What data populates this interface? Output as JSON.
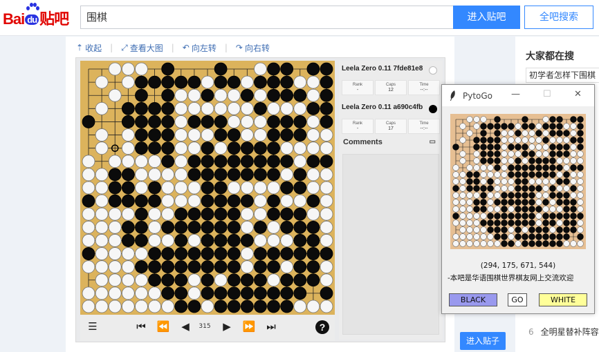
{
  "header": {
    "logo_text_a": "Bai",
    "logo_text_b": "du",
    "logo_text_c": "贴吧",
    "search_value": "围棋",
    "enter_bar_label": "进入贴吧",
    "search_all_label": "全吧搜索"
  },
  "toolbar": {
    "collapse_label": "收起",
    "view_large_label": "查看大图",
    "rotate_left_label": "向左转",
    "rotate_right_label": "向右转"
  },
  "go_viewer": {
    "board_size": 19,
    "last_move": [
      6,
      2
    ],
    "board": [
      "..ooo.x...x..oxx.xx",
      ".o.oxxxxxoxxoxxxoox",
      "..o.x.xooxooxoxxxox",
      ".o.xxxxooooooxoooxx",
      "x..xxxxoxxxoooxxxox",
      ".o.oxxxoooxxooxxxoo",
      ".o.oxxxooxoxxxxoooo",
      "o.ooooxoxxxxxxxxoxx",
      "ooxxooooxxxxxxxoxoo",
      "ooxxoxoooxxooooxxoo",
      "xoxxxxoooxxxxoxooxo",
      "ooooxooxxxxxooxxxoo",
      "oooxxoxxxxxxoxoxxxo",
      "oooxxooxoxxxxoooxxo",
      "xooooxxxxxxxoxxxxxx",
      "ooooxxxxxxxxoxxoxxo",
      ".ooooxxxoxoxxxoxxxo",
      "ooooooxxoxxxxxxxx.x",
      "oooooooxxoxxxxxxooo"
    ],
    "players": [
      {
        "name": "Leela Zero 0.11 7fde81e8",
        "stone": "white",
        "rank_label": "Rank",
        "rank": "-",
        "caps_label": "Caps",
        "caps": "12",
        "time_label": "Time",
        "time": "--:--"
      },
      {
        "name": "Leela Zero 0.11 a690c4fb",
        "stone": "black",
        "rank_label": "Rank",
        "rank": "-",
        "caps_label": "Caps",
        "caps": "17",
        "time_label": "Time",
        "time": "--:--"
      }
    ],
    "comments_label": "Comments",
    "move_number": "315",
    "help_label": "?"
  },
  "sidebar": {
    "title": "大家都在搜",
    "item1": "初学者怎样下围棋",
    "item6_num": "6",
    "item6": "全明星替补阵容",
    "post_button": "进入贴子"
  },
  "pytogo": {
    "title": "PytoGo",
    "coords": "(294, 175, 671, 544)",
    "motto": "-本吧是华语围棋世界棋友网上交流欢迎",
    "black_button": "BLACK",
    "go_button": "GO",
    "white_button": "WHITE",
    "black_button_color": "#9999ee",
    "white_button_color": "#ffff99",
    "board_color": "#e6bf93"
  }
}
